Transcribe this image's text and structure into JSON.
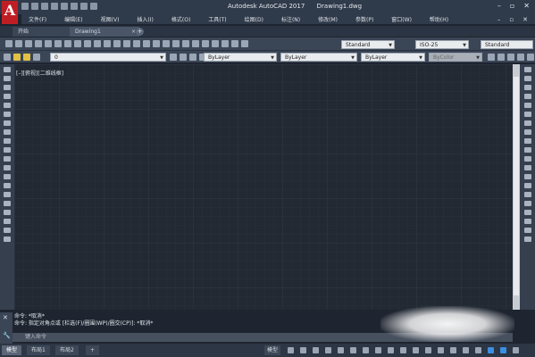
{
  "app": {
    "title": "Autodesk AutoCAD 2017",
    "document": "Drawing1.dwg",
    "logo_letter": "A"
  },
  "menu": [
    "文件(F)",
    "编辑(E)",
    "视图(V)",
    "插入(I)",
    "格式(O)",
    "工具(T)",
    "绘图(D)",
    "标注(N)",
    "修改(M)",
    "参数(P)",
    "窗口(W)",
    "帮助(H)"
  ],
  "tabs": [
    {
      "label": "开始"
    },
    {
      "label": "Drawing1",
      "close": "×"
    }
  ],
  "tab_add": "+",
  "window_controls": {
    "minimize": "–",
    "maximize": "▫",
    "close": "✕"
  },
  "menu_controls": {
    "minimize": "–",
    "maximize": "▫",
    "close": "✕"
  },
  "styles": {
    "text_style": "Standard",
    "dim_style": "ISO-25",
    "table_style": "Standard"
  },
  "layers": {
    "current": "0",
    "color": "ByLayer",
    "linetype": "ByLayer",
    "lineweight": "ByLayer",
    "plotstyle": "ByColor"
  },
  "viewport_label": "[–][俯视][二维线框]",
  "command": {
    "history": [
      "命令: *取消*",
      "命令: 指定对角点或 [栏选(F)/圈围(WP)/圈交(CP)]: *取消*"
    ],
    "placeholder": "键入命令",
    "close_icon": "✕",
    "wrench_icon": "🔧"
  },
  "status": {
    "layout_tabs": [
      "模型",
      "布局1",
      "布局2"
    ],
    "model_button": "模型",
    "add_layout": "+"
  },
  "colors": {
    "canvas": "#222933",
    "accent_red": "#bf1f24",
    "status_blue": "#3b8fe3"
  }
}
